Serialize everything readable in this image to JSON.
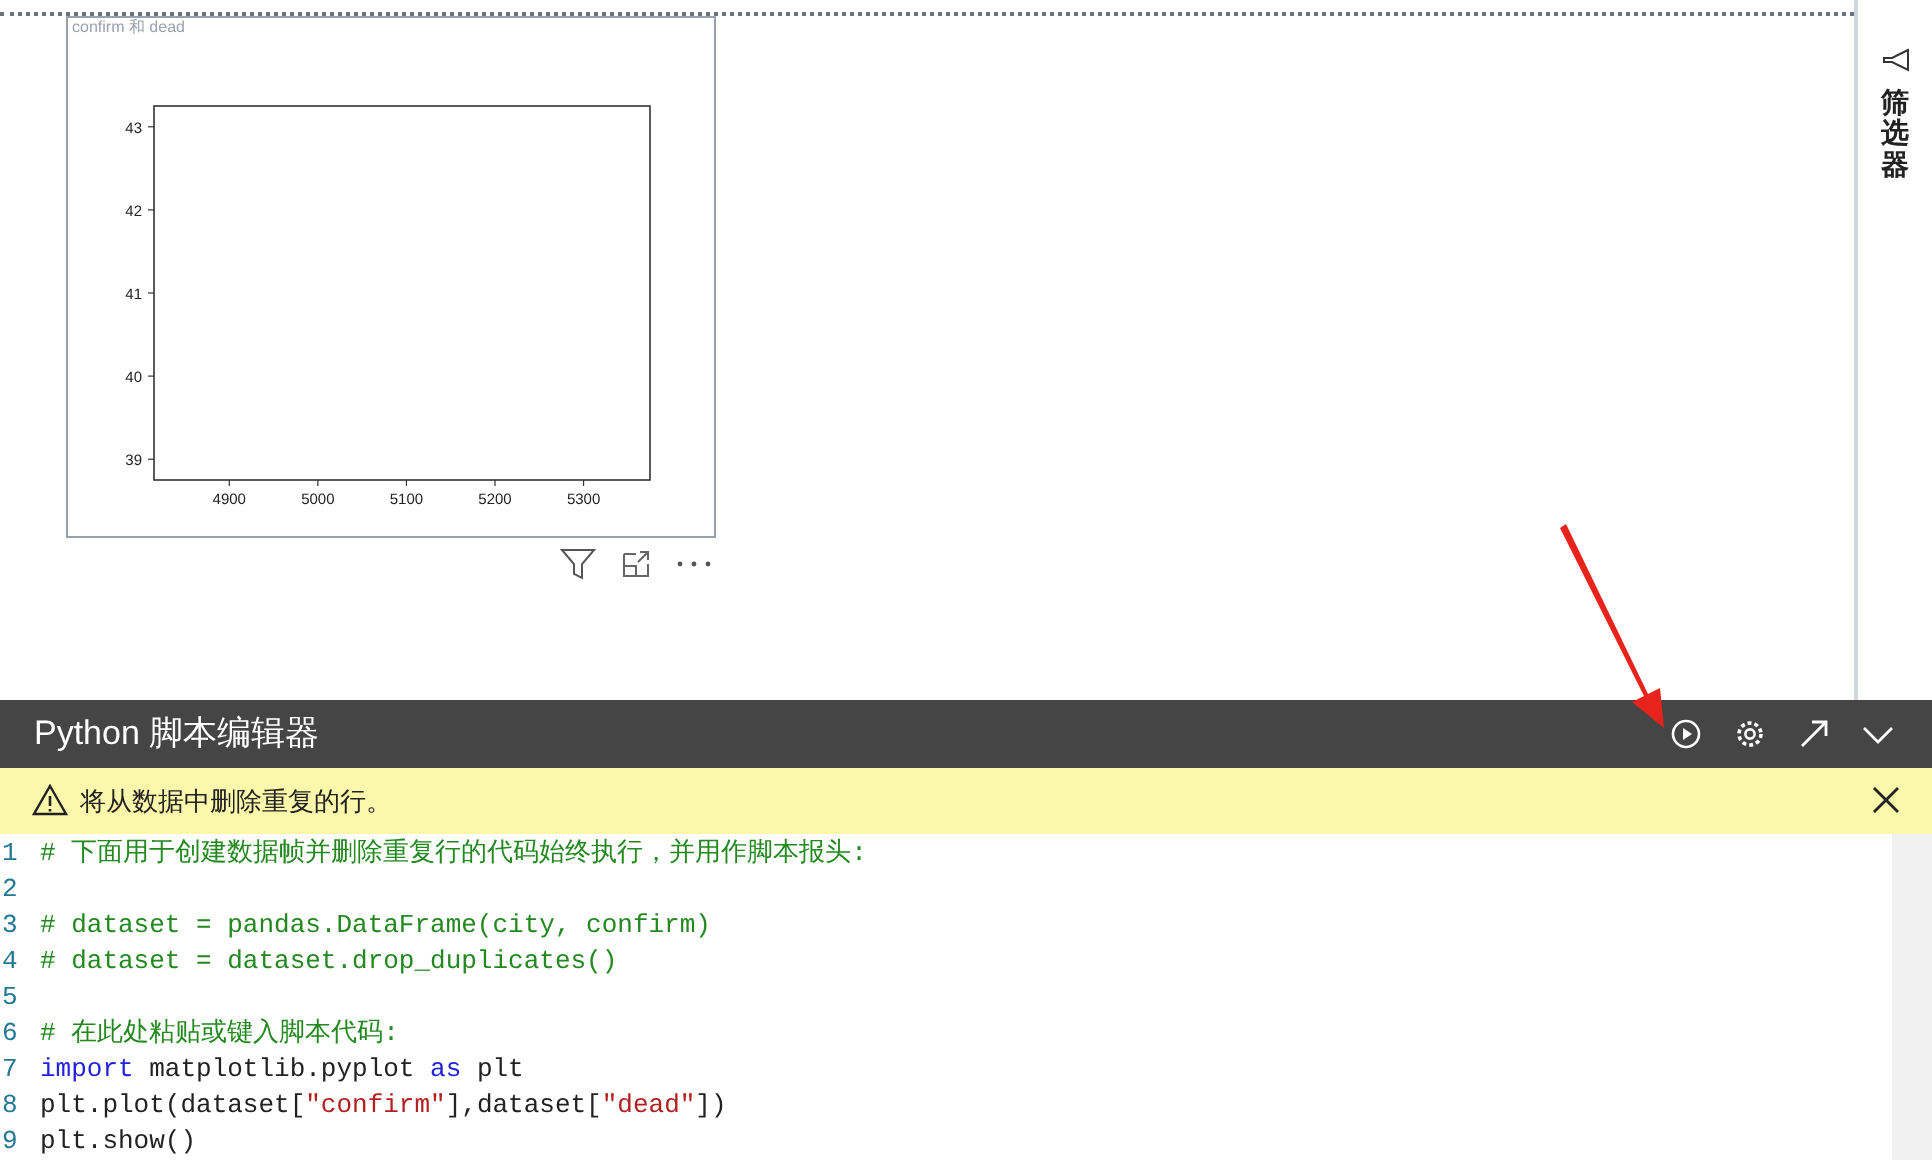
{
  "visual": {
    "title": "confirm 和 dead",
    "chart_data": {
      "type": "line",
      "xticks": [
        4900,
        5000,
        5100,
        5200,
        5300
      ],
      "yticks": [
        39,
        40,
        41,
        42,
        43
      ],
      "xlim": [
        4815,
        5375
      ],
      "ylim": [
        38.75,
        43.25
      ]
    }
  },
  "filter_pane": {
    "title": "筛选器"
  },
  "editor": {
    "title": "Python 脚本编辑器",
    "warning": "将从数据中删除重复的行。",
    "lines": [
      {
        "number": "1",
        "tokens": [
          {
            "text": "# 下面用于创建数据帧并删除重复行的代码始终执行，并用作脚本报头:",
            "kind": "comment"
          }
        ]
      },
      {
        "number": "2"
      },
      {
        "number": "3",
        "tokens": [
          {
            "text": "# dataset = pandas.DataFrame(city, confirm)",
            "kind": "comment"
          }
        ]
      },
      {
        "number": "4",
        "tokens": [
          {
            "text": "# dataset = dataset.drop_duplicates()",
            "kind": "comment"
          }
        ]
      },
      {
        "number": "5"
      },
      {
        "number": "6",
        "tokens": [
          {
            "text": "# 在此处粘贴或键入脚本代码:",
            "kind": "comment"
          }
        ]
      },
      {
        "number": "7",
        "tokens": [
          {
            "text": "import",
            "kind": "keyword"
          },
          {
            "text": " matplotlib.pyplot ",
            "kind": "plain"
          },
          {
            "text": "as",
            "kind": "keyword"
          },
          {
            "text": " plt",
            "kind": "plain"
          }
        ]
      },
      {
        "number": "8",
        "tokens": [
          {
            "text": "plt.plot(dataset[",
            "kind": "plain"
          },
          {
            "text": "\"confirm\"",
            "kind": "string"
          },
          {
            "text": "],dataset[",
            "kind": "plain"
          },
          {
            "text": "\"dead\"",
            "kind": "string"
          },
          {
            "text": "])",
            "kind": "plain"
          }
        ]
      },
      {
        "number": "9",
        "tokens": [
          {
            "text": "plt.show()",
            "kind": "plain"
          }
        ]
      }
    ]
  }
}
